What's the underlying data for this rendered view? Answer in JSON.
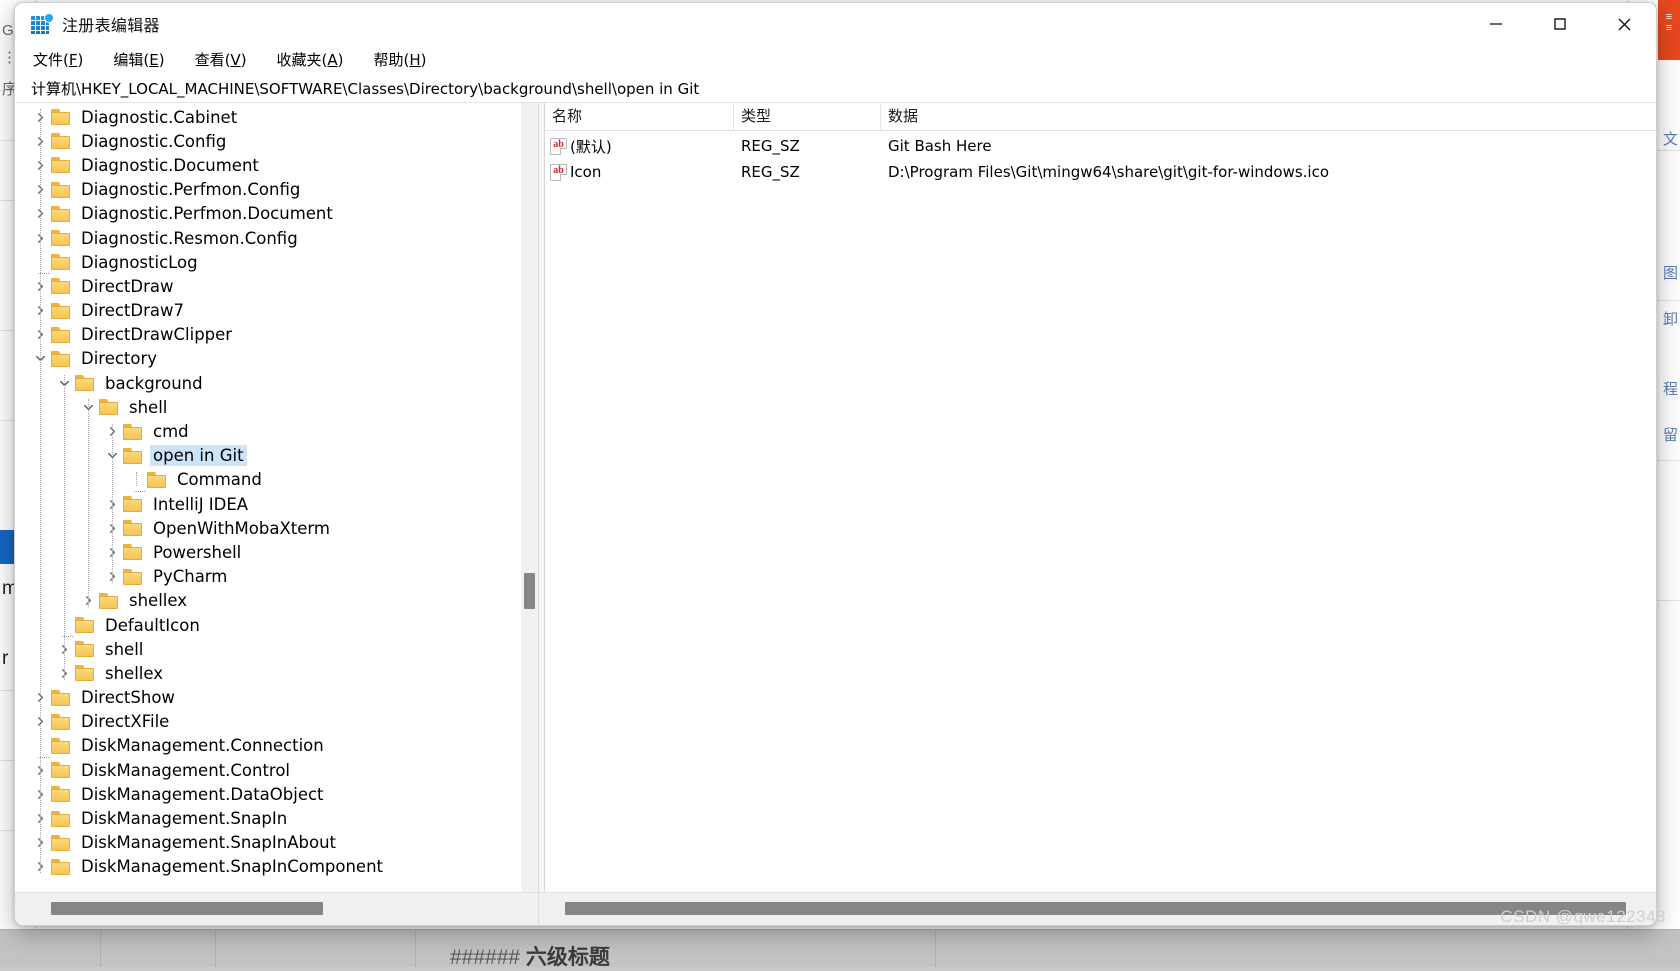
{
  "window": {
    "title": "注册表编辑器",
    "icon": "registry-editor-icon",
    "controls": {
      "minimize": "—",
      "maximize": "□",
      "close": "✕"
    }
  },
  "menubar": [
    {
      "name": "file",
      "pre": "文件(",
      "key": "F",
      "post": ")"
    },
    {
      "name": "edit",
      "pre": "编辑(",
      "key": "E",
      "post": ")"
    },
    {
      "name": "view",
      "pre": "查看(",
      "key": "V",
      "post": ")"
    },
    {
      "name": "favorites",
      "pre": "收藏夹(",
      "key": "A",
      "post": ")"
    },
    {
      "name": "help",
      "pre": "帮助(",
      "key": "H",
      "post": ")"
    }
  ],
  "address": {
    "path": "计算机\\HKEY_LOCAL_MACHINE\\SOFTWARE\\Classes\\Directory\\background\\shell\\open in Git"
  },
  "tree": {
    "items": [
      {
        "label": "Diagnostic.Cabinet",
        "depth": 1,
        "state": "collapsed"
      },
      {
        "label": "Diagnostic.Config",
        "depth": 1,
        "state": "collapsed"
      },
      {
        "label": "Diagnostic.Document",
        "depth": 1,
        "state": "collapsed"
      },
      {
        "label": "Diagnostic.Perfmon.Config",
        "depth": 1,
        "state": "collapsed"
      },
      {
        "label": "Diagnostic.Perfmon.Document",
        "depth": 1,
        "state": "collapsed"
      },
      {
        "label": "Diagnostic.Resmon.Config",
        "depth": 1,
        "state": "collapsed"
      },
      {
        "label": "DiagnosticLog",
        "depth": 1,
        "state": "leaf"
      },
      {
        "label": "DirectDraw",
        "depth": 1,
        "state": "collapsed"
      },
      {
        "label": "DirectDraw7",
        "depth": 1,
        "state": "collapsed"
      },
      {
        "label": "DirectDrawClipper",
        "depth": 1,
        "state": "collapsed"
      },
      {
        "label": "Directory",
        "depth": 1,
        "state": "expanded"
      },
      {
        "label": "background",
        "depth": 2,
        "state": "expanded"
      },
      {
        "label": "shell",
        "depth": 3,
        "state": "expanded"
      },
      {
        "label": "cmd",
        "depth": 4,
        "state": "collapsed"
      },
      {
        "label": "open in Git",
        "depth": 4,
        "state": "expanded",
        "selected": true
      },
      {
        "label": "Command",
        "depth": 5,
        "state": "leaf"
      },
      {
        "label": "IntelliJ IDEA",
        "depth": 4,
        "state": "collapsed"
      },
      {
        "label": "OpenWithMobaXterm",
        "depth": 4,
        "state": "collapsed"
      },
      {
        "label": "Powershell",
        "depth": 4,
        "state": "collapsed"
      },
      {
        "label": "PyCharm",
        "depth": 4,
        "state": "collapsed"
      },
      {
        "label": "shellex",
        "depth": 3,
        "state": "collapsed"
      },
      {
        "label": "DefaultIcon",
        "depth": 2,
        "state": "leaf"
      },
      {
        "label": "shell",
        "depth": 2,
        "state": "collapsed"
      },
      {
        "label": "shellex",
        "depth": 2,
        "state": "collapsed"
      },
      {
        "label": "DirectShow",
        "depth": 1,
        "state": "collapsed"
      },
      {
        "label": "DirectXFile",
        "depth": 1,
        "state": "collapsed"
      },
      {
        "label": "DiskManagement.Connection",
        "depth": 1,
        "state": "leaf"
      },
      {
        "label": "DiskManagement.Control",
        "depth": 1,
        "state": "collapsed"
      },
      {
        "label": "DiskManagement.DataObject",
        "depth": 1,
        "state": "collapsed"
      },
      {
        "label": "DiskManagement.SnapIn",
        "depth": 1,
        "state": "collapsed"
      },
      {
        "label": "DiskManagement.SnapInAbout",
        "depth": 1,
        "state": "collapsed"
      },
      {
        "label": "DiskManagement.SnapInComponent",
        "depth": 1,
        "state": "collapsed"
      }
    ]
  },
  "values": {
    "columns": [
      "名称",
      "类型",
      "数据"
    ],
    "rows": [
      {
        "name": "(默认)",
        "type": "REG_SZ",
        "data": "Git Bash Here"
      },
      {
        "name": "Icon",
        "type": "REG_SZ",
        "data": "D:\\Program Files\\Git\\mingw64\\share\\git\\git-for-windows.ico"
      }
    ]
  },
  "watermark": {
    "text": "CSDN @qwe122343"
  },
  "background": {
    "bottom_text_hashes": "######",
    "bottom_text_title": "六级标题",
    "left_glyphs": [
      "G",
      "⋮",
      "序",
      "]",
      "m",
      "r"
    ],
    "right_glyphs": [
      "文",
      "图",
      "卸",
      "程",
      "留"
    ],
    "accent_orange": "#e8491f",
    "accent_blue": "#1668c5"
  }
}
